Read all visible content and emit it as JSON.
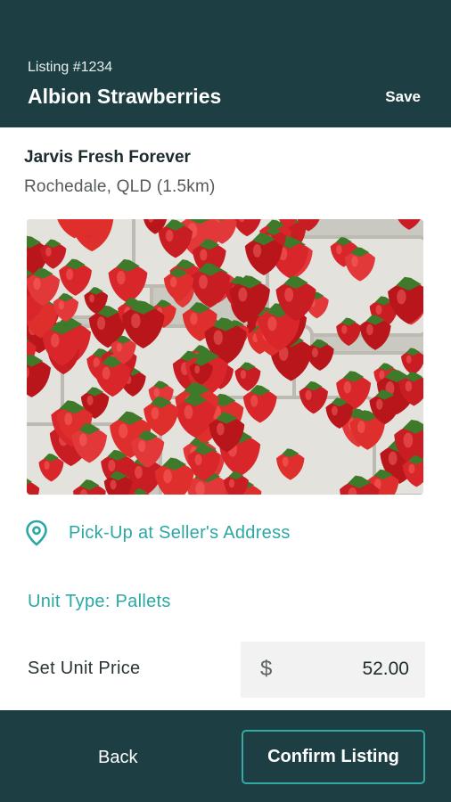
{
  "header": {
    "listing_number": "Listing #1234",
    "title": "Albion Strawberries",
    "save_label": "Save"
  },
  "seller": {
    "name": "Jarvis Fresh Forever",
    "location": "Rochedale, QLD (1.5km)"
  },
  "product_image": {
    "icon": "strawberries-photo"
  },
  "pickup": {
    "icon": "location-pin-icon",
    "label": "Pick-Up at Seller's Address"
  },
  "unit_type": {
    "label": "Unit Type: Pallets"
  },
  "price": {
    "label": "Set Unit Price",
    "currency_symbol": "$",
    "value": "52.00"
  },
  "footer": {
    "back_label": "Back",
    "confirm_label": "Confirm Listing"
  },
  "colors": {
    "header_bg": "#1d3f44",
    "accent": "#2ba8a4",
    "button_border": "#33a9a4"
  }
}
